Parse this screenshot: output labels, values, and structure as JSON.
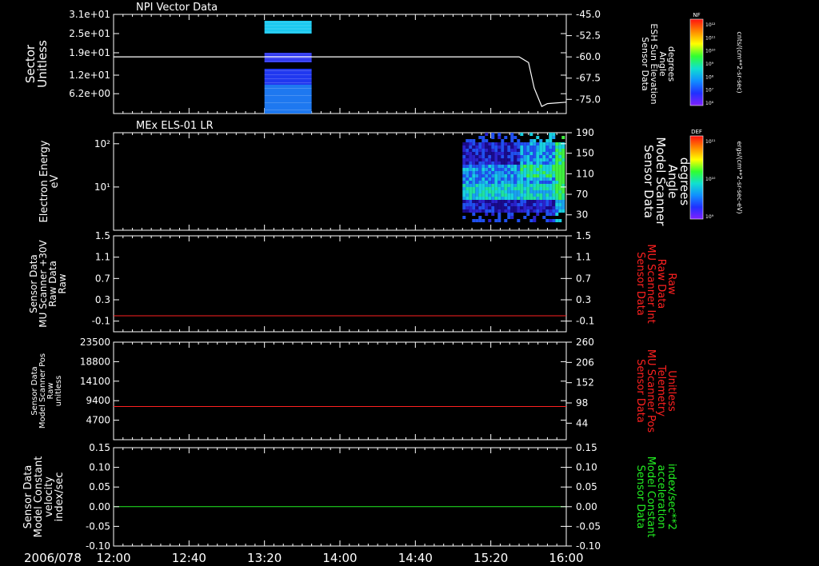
{
  "date_label": "2006/078",
  "time_ticks": [
    "12:00",
    "12:40",
    "13:20",
    "14:00",
    "14:40",
    "15:20",
    "16:00"
  ],
  "colorbars": [
    {
      "label": "NF",
      "units": "cnts/(cm**2-sr-sec)",
      "ticks": [
        "10¹²",
        "10¹¹",
        "10¹⁰",
        "10⁹",
        "10⁸",
        "10⁷",
        "10⁶"
      ]
    },
    {
      "label": "DEF",
      "units": "ergs/(cm**2-sr-sec-eV)",
      "ticks": [
        "10¹¹",
        "10¹⁰",
        "10⁹"
      ]
    }
  ],
  "chart_data": [
    {
      "type": "heatmap",
      "title": "NPI Vector Data",
      "ylabel": [
        "Sector",
        "Unitless"
      ],
      "y_ticks": [
        "3.1e+01",
        "2.5e+01",
        "1.9e+01",
        "1.2e+01",
        "6.2e+00"
      ],
      "ylim": [
        0,
        31
      ],
      "right_ylabel": [
        "Sensor Data",
        "ESH Sun Elevation",
        "Angle",
        "degrees"
      ],
      "right_ticks": [
        "-45.0",
        "-52.5",
        "-60.0",
        "-67.5",
        "-75.0"
      ],
      "right_ylim": [
        -80,
        -45
      ],
      "heat_blocks": [
        {
          "t0": "13:20",
          "t1": "13:45",
          "y0": 25,
          "y1": 29,
          "color": "#19c8f0"
        },
        {
          "t0": "13:20",
          "t1": "13:45",
          "y0": 16,
          "y1": 19,
          "color": "#2a33ee"
        },
        {
          "t0": "13:20",
          "t1": "13:45",
          "y0": 9,
          "y1": 14,
          "color": "#2038f0"
        },
        {
          "t0": "13:20",
          "t1": "13:45",
          "y0": 0,
          "y1": 9,
          "color": "#1e78f0"
        }
      ],
      "line_series": {
        "axis": "right",
        "color": "#ffffff",
        "points": [
          [
            "12:00",
            -60
          ],
          [
            "15:35",
            -60
          ],
          [
            "15:40",
            -62
          ],
          [
            "15:43",
            -71
          ],
          [
            "15:47",
            -77.5
          ],
          [
            "15:50",
            -76.5
          ],
          [
            "16:00",
            -76
          ]
        ]
      }
    },
    {
      "type": "heatmap",
      "title": "MEx ELS-01 LR",
      "ylabel": [
        "Electron Energy",
        "eV"
      ],
      "y_ticks": [
        "10²",
        "10¹"
      ],
      "y_tick_values": [
        100,
        10
      ],
      "ylim": [
        1,
        180
      ],
      "yscale": "log",
      "right_ylabel": [
        "Sensor Data",
        "Model Scanner",
        "Angle",
        "degrees"
      ],
      "right_ticks": [
        "190",
        "150",
        "110",
        "70",
        "30"
      ],
      "right_ylim": [
        0,
        190
      ],
      "heat_region": {
        "t0": "15:05",
        "t1": "16:00",
        "ymin": 1.3,
        "ymax": 180
      }
    },
    {
      "type": "line",
      "ylabel": [
        "Sensor Data",
        "MU Scanner +30V",
        "Raw Data",
        "Raw"
      ],
      "y_ticks": [
        "1.5",
        "1.1",
        "0.7",
        "0.3",
        "-0.1"
      ],
      "ylim": [
        -0.3,
        1.5
      ],
      "right_ylabel": [
        "Sensor Data",
        "MU Scanner Int",
        "Raw Data",
        "Raw"
      ],
      "right_ticks": [
        "1.5",
        "1.1",
        "0.7",
        "0.3",
        "-0.1"
      ],
      "right_ylim": [
        -0.3,
        1.5
      ],
      "right_label_color": "#ff2020",
      "series": [
        {
          "color": "#ff2020",
          "values": [
            [
              "12:00",
              0.0
            ],
            [
              "16:00",
              0.0
            ]
          ]
        }
      ]
    },
    {
      "type": "line",
      "ylabel": [
        "Sensor Data",
        "Model Scanner Pos",
        "Raw",
        "unitless"
      ],
      "y_ticks": [
        "23500",
        "18800",
        "14100",
        "9400",
        "4700"
      ],
      "ylim": [
        0,
        23500
      ],
      "right_ylabel": [
        "Sensor Data",
        "MU Scanner Pos",
        "Telemetry",
        "Unitless"
      ],
      "right_ticks": [
        "260",
        "206",
        "152",
        "98",
        "44"
      ],
      "right_ylim": [
        0,
        260
      ],
      "right_label_color": "#ff2020",
      "series": [
        {
          "color": "#ff2020",
          "values": [
            [
              "12:00",
              8000
            ],
            [
              "16:00",
              8000
            ]
          ]
        }
      ]
    },
    {
      "type": "line",
      "ylabel": [
        "Sensor Data",
        "Model Constant",
        "velocity",
        "index/sec"
      ],
      "y_ticks": [
        "0.15",
        "0.10",
        "0.05",
        "0.00",
        "-0.05",
        "-0.10"
      ],
      "ylim": [
        -0.1,
        0.15
      ],
      "right_ylabel": [
        "Sensor Data",
        "Model Constant",
        "acceleration",
        "index/sec**2"
      ],
      "right_ticks": [
        "0.15",
        "0.10",
        "0.05",
        "0.00",
        "-0.05",
        "-0.10"
      ],
      "right_ylim": [
        -0.1,
        0.15
      ],
      "right_label_color": "#22ee22",
      "series": [
        {
          "color": "#22ee22",
          "values": [
            [
              "12:00",
              0.0
            ],
            [
              "16:00",
              0.0
            ]
          ]
        }
      ]
    }
  ]
}
